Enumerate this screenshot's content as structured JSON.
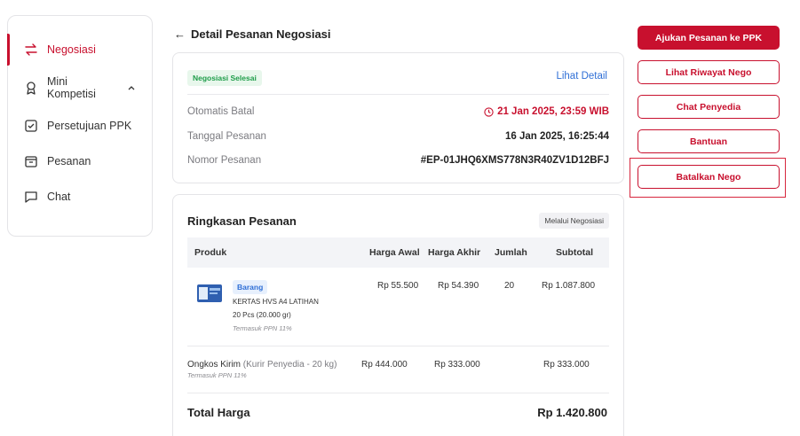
{
  "sidebar": {
    "items": [
      {
        "label": "Negosiasi",
        "icon": "swap-arrows-icon"
      },
      {
        "label": "Mini Kompetisi",
        "icon": "award-icon"
      },
      {
        "label": "Persetujuan PPK",
        "icon": "check-square-icon"
      },
      {
        "label": "Pesanan",
        "icon": "box-icon"
      },
      {
        "label": "Chat",
        "icon": "chat-bubble-icon"
      }
    ]
  },
  "header": {
    "back": "←",
    "title": "Detail Pesanan Negosiasi"
  },
  "status_card": {
    "badge": "Negosiasi Selesai",
    "detail_link": "Lihat Detail",
    "rows": [
      {
        "label": "Otomatis Batal",
        "value": "21 Jan 2025, 23:59 WIB"
      },
      {
        "label": "Tanggal Pesanan",
        "value": "16 Jan 2025, 16:25:44"
      },
      {
        "label": "Nomor Pesanan",
        "value": "#EP-01JHQ6XMS778N3R40ZV1D12BFJ"
      }
    ]
  },
  "summary": {
    "title": "Ringkasan Pesanan",
    "badge": "Melalui Negosiasi",
    "columns": [
      "Produk",
      "Harga Awal",
      "Harga Akhir",
      "Jumlah",
      "Subtotal"
    ],
    "product": {
      "tag": "Barang",
      "name": "KERTAS HVS A4 LATIHAN",
      "variant": "20 Pcs (20.000 gr)",
      "tax": "Termasuk PPN 11%",
      "harga_awal": "Rp 55.500",
      "harga_akhir": "Rp 54.390",
      "jumlah": "20",
      "subtotal": "Rp 1.087.800"
    },
    "shipping": {
      "label": "Ongkos Kirim",
      "courier": "(Kurir Penyedia - 20 kg)",
      "tax": "Termasuk PPN 11%",
      "harga_awal": "Rp 444.000",
      "harga_akhir": "Rp 333.000",
      "subtotal": "Rp 333.000"
    },
    "total_label": "Total Harga",
    "total_value": "Rp 1.420.800"
  },
  "actions": {
    "submit": "Ajukan Pesanan ke PPK",
    "history": "Lihat Riwayat Nego",
    "chat": "Chat Penyedia",
    "help": "Bantuan",
    "cancel": "Batalkan Nego"
  },
  "colors": {
    "accent": "#c8102e",
    "link": "#2f6fd6",
    "success": "#1f9d4a"
  }
}
